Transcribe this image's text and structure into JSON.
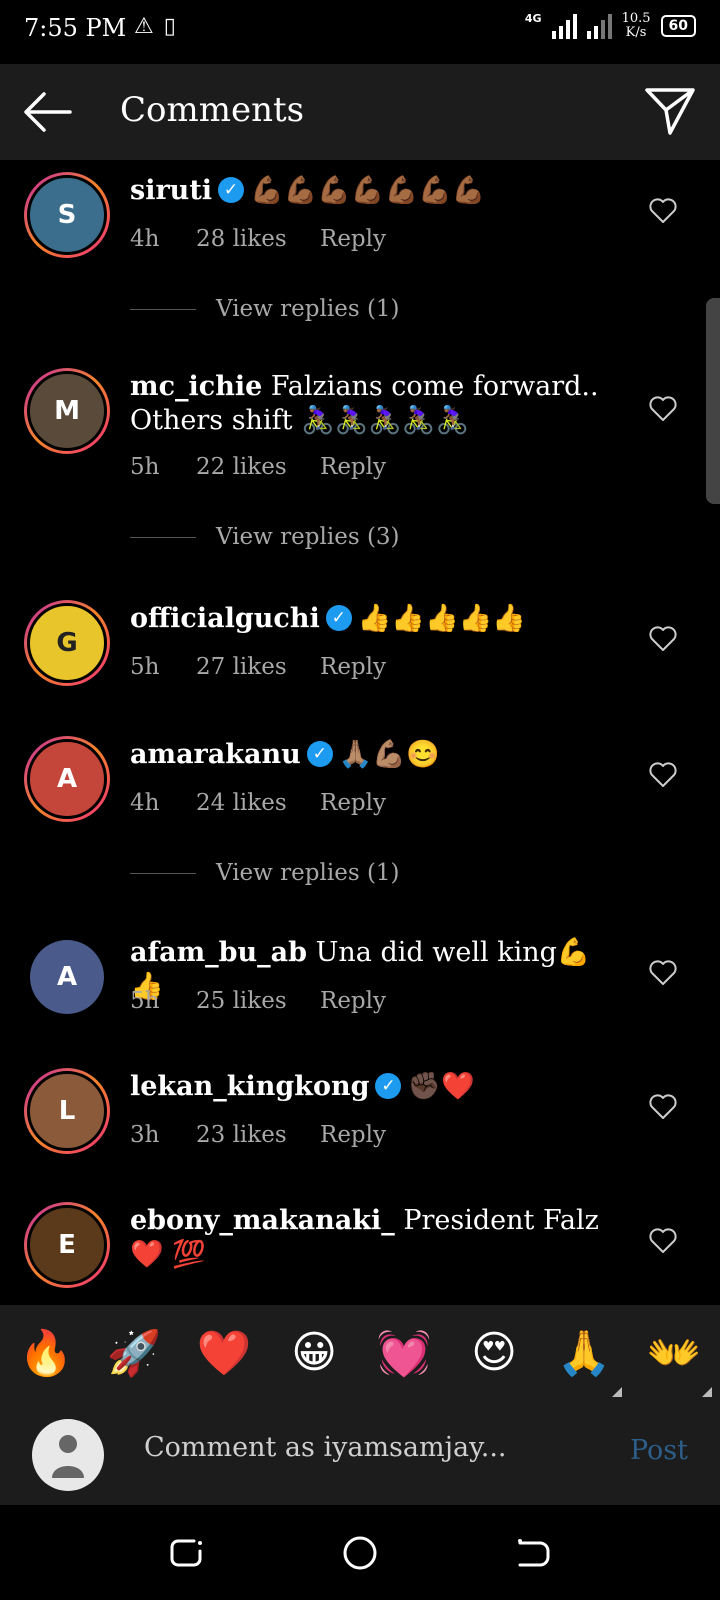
{
  "status_bar": {
    "time": "7:55 PM",
    "network_label": "4G",
    "speed_value": "10.5",
    "speed_unit": "K/s",
    "battery": "60"
  },
  "header": {
    "title": "Comments"
  },
  "reply_label": "Reply",
  "comments": [
    {
      "username": "siruti",
      "verified": true,
      "text": "💪🏾💪🏾💪🏾💪🏾💪🏾💪🏾💪🏾",
      "time": "4h",
      "likes": "28 likes",
      "view_replies": "View replies (1)",
      "avatar_initial": "S"
    },
    {
      "username": "mc_ichie",
      "verified": false,
      "text": "Falzians come forward.. Others shift 🚴🏾‍♀️🚴🏾‍♀️🚴🏾‍♀️🚴🏾‍♀️🚴🏾‍♀️",
      "time": "5h",
      "likes": "22 likes",
      "view_replies": "View replies (3)",
      "avatar_initial": "M"
    },
    {
      "username": "officialguchi",
      "verified": true,
      "text": "👍👍👍👍👍",
      "time": "5h",
      "likes": "27 likes",
      "view_replies": "",
      "avatar_initial": "G"
    },
    {
      "username": "amarakanu",
      "verified": true,
      "text": "🙏🏽💪🏽😊",
      "time": "4h",
      "likes": "24 likes",
      "view_replies": "View replies (1)",
      "avatar_initial": "A"
    },
    {
      "username": "afam_bu_ab",
      "verified": false,
      "text": "Una did well king💪👍",
      "time": "5h",
      "likes": "25 likes",
      "view_replies": "",
      "avatar_initial": "A"
    },
    {
      "username": "lekan_kingkong",
      "verified": true,
      "text": "✊🏿❤️",
      "time": "3h",
      "likes": "23 likes",
      "view_replies": "",
      "avatar_initial": "L"
    },
    {
      "username": "ebony_makanaki_",
      "verified": false,
      "text": "President Falz ❤️ 💯",
      "time": "",
      "likes": "",
      "view_replies": "",
      "avatar_initial": "E"
    }
  ],
  "emoji_bar": [
    "🔥",
    "🚀",
    "❤️",
    "😀",
    "💓",
    "😍",
    "🙏",
    "👐"
  ],
  "compose": {
    "placeholder": "Comment as iyamsamjay...",
    "post_label": "Post"
  },
  "colors": {
    "background": "#000000",
    "bar": "#1c1c1c",
    "verified": "#1d9bf0",
    "meta_text": "#a8a8a8",
    "post_disabled": "#2c5e89"
  }
}
